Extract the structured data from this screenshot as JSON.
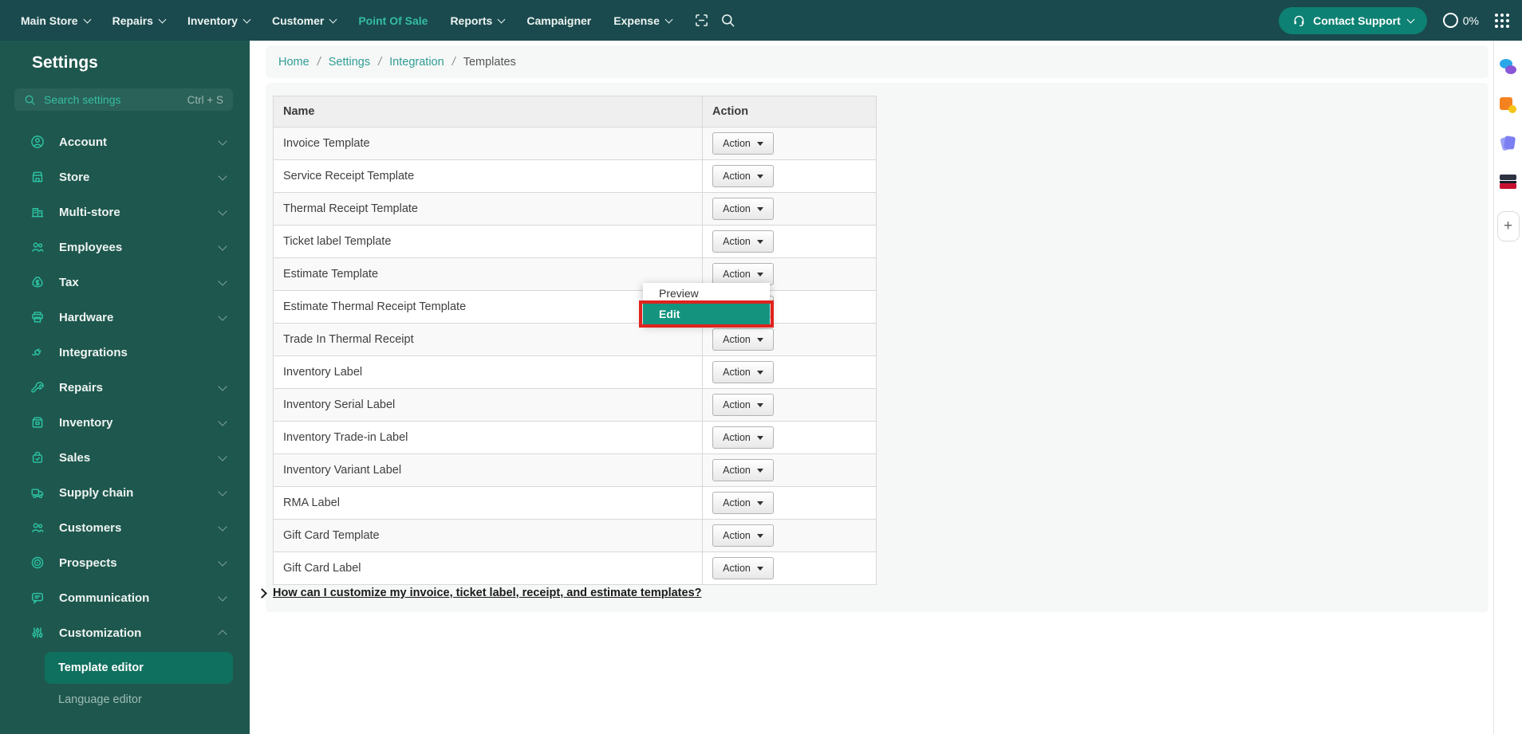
{
  "navbar": {
    "items": [
      {
        "label": "Main Store",
        "chevron": true,
        "active": false
      },
      {
        "label": "Repairs",
        "chevron": true,
        "active": false
      },
      {
        "label": "Inventory",
        "chevron": true,
        "active": false
      },
      {
        "label": "Customer",
        "chevron": true,
        "active": false
      },
      {
        "label": "Point Of Sale",
        "chevron": false,
        "active": true
      },
      {
        "label": "Reports",
        "chevron": true,
        "active": false
      },
      {
        "label": "Campaigner",
        "chevron": false,
        "active": false
      },
      {
        "label": "Expense",
        "chevron": true,
        "active": false
      }
    ],
    "tools": [
      {
        "icon": "scan-icon"
      },
      {
        "icon": "search-icon"
      }
    ],
    "contact_support": {
      "label": "Contact Support",
      "icon": "headset-icon"
    },
    "usage": {
      "value": "0%"
    },
    "apps_icon": "grid-apps-icon"
  },
  "sidebar": {
    "title": "Settings",
    "search": {
      "placeholder": "Search settings",
      "shortcut": "Ctrl + S",
      "icon": "search-icon"
    },
    "items": [
      {
        "label": "Account",
        "icon": "account-icon",
        "chevron": "down"
      },
      {
        "label": "Store",
        "icon": "store-icon",
        "chevron": "down"
      },
      {
        "label": "Multi-store",
        "icon": "multistore-icon",
        "chevron": "down"
      },
      {
        "label": "Employees",
        "icon": "employees-icon",
        "chevron": "down"
      },
      {
        "label": "Tax",
        "icon": "tax-icon",
        "chevron": "down"
      },
      {
        "label": "Hardware",
        "icon": "hardware-icon",
        "chevron": "down"
      },
      {
        "label": "Integrations",
        "icon": "integrations-icon",
        "chevron": "none"
      },
      {
        "label": "Repairs",
        "icon": "repairs-icon",
        "chevron": "down"
      },
      {
        "label": "Inventory",
        "icon": "inventory-icon",
        "chevron": "down"
      },
      {
        "label": "Sales",
        "icon": "sales-icon",
        "chevron": "down"
      },
      {
        "label": "Supply chain",
        "icon": "supplychain-icon",
        "chevron": "down"
      },
      {
        "label": "Customers",
        "icon": "customers-icon",
        "chevron": "down"
      },
      {
        "label": "Prospects",
        "icon": "prospects-icon",
        "chevron": "down"
      },
      {
        "label": "Communication",
        "icon": "communication-icon",
        "chevron": "down"
      },
      {
        "label": "Customization",
        "icon": "customization-icon",
        "chevron": "up",
        "expanded": true,
        "children": [
          {
            "label": "Template editor",
            "active": true
          },
          {
            "label": "Language editor",
            "active": false
          }
        ]
      }
    ]
  },
  "breadcrumb": {
    "separator": "/",
    "items": [
      {
        "label": "Home",
        "link": true
      },
      {
        "label": "Settings",
        "link": true
      },
      {
        "label": "Integration",
        "link": true
      },
      {
        "label": "Templates",
        "link": false
      }
    ]
  },
  "table": {
    "columns": [
      "Name",
      "Action"
    ],
    "action_label": "Action",
    "rows": [
      "Invoice Template",
      "Service Receipt Template",
      "Thermal Receipt Template",
      "Ticket label Template",
      "Estimate Template",
      "Estimate Thermal Receipt Template",
      "Trade In Thermal Receipt",
      "Inventory Label",
      "Inventory Serial Label",
      "Inventory Trade-in Label",
      "Inventory Variant Label",
      "RMA Label",
      "Gift Card Template",
      "Gift Card Label"
    ]
  },
  "context_menu": {
    "items": [
      {
        "label": "Preview",
        "highlighted": false
      },
      {
        "label": "Edit",
        "highlighted": true,
        "annotated": true
      }
    ]
  },
  "footer_link": {
    "label": "How can I customize my invoice, ticket label, receipt, and estimate templates?"
  },
  "right_strip": {
    "icons": [
      "chat-app-icon",
      "shapes-app-icon",
      "notes-app-icon",
      "flag-app-icon"
    ],
    "add_button": "add-icon"
  },
  "colors": {
    "navbar_bg": "#1a4a4e",
    "sidebar_bg": "#1e574e",
    "accent_teal": "#35bda1",
    "support_button": "#0d8173",
    "active_item_bg": "#10705f",
    "edit_highlight": "#14947f",
    "annotation_red": "#e0231e",
    "breadcrumb_link": "#2f9e94"
  }
}
